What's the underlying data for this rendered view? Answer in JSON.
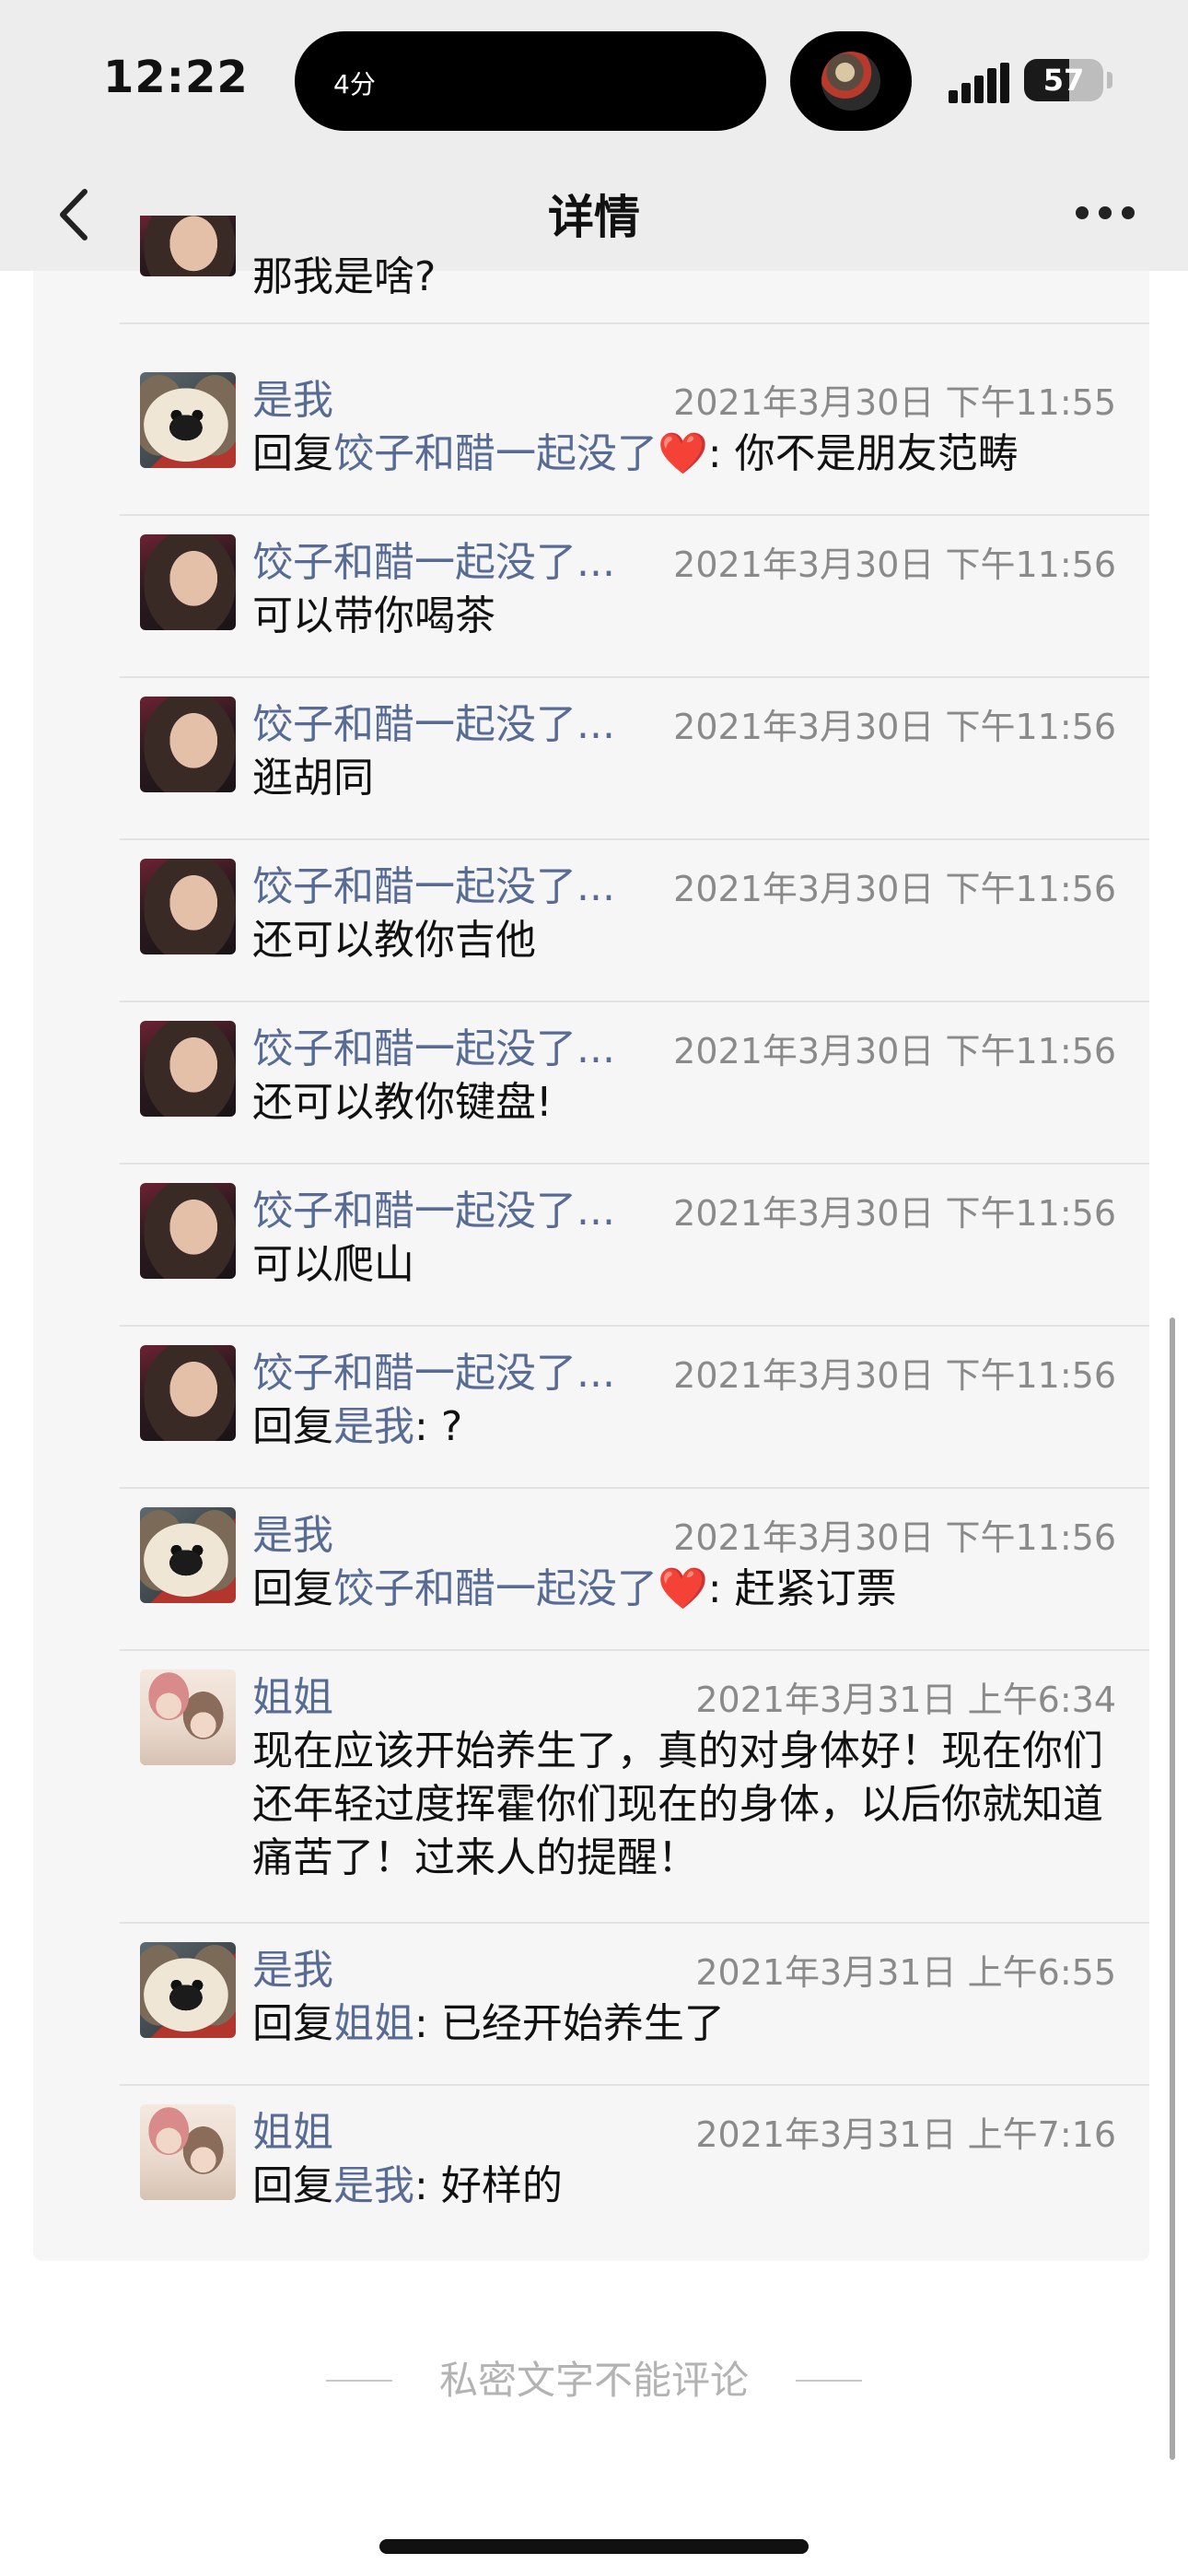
{
  "status_bar": {
    "time": "12:22",
    "island_label": "4分",
    "battery_level": "57",
    "battery_fraction": 0.57
  },
  "nav": {
    "title": "详情",
    "back_icon": "chevron-left-icon",
    "more_icon": "more-dots-icon"
  },
  "comments": [
    {
      "avatar": "girl",
      "name": "",
      "timestamp": "",
      "reply_prefix": "",
      "reply_to": "",
      "reply_sep": "",
      "text": "那我是啥?"
    },
    {
      "avatar": "dog",
      "name": "是我",
      "timestamp": "2021年3月30日 下午11:55",
      "reply_prefix": "回复",
      "reply_to": "饺子和醋一起没了",
      "reply_heart": "❤️",
      "reply_sep": ":",
      "text": " 你不是朋友范畴"
    },
    {
      "avatar": "girl",
      "name": "饺子和醋一起没了...",
      "timestamp": "2021年3月30日 下午11:56",
      "reply_prefix": "",
      "reply_to": "",
      "reply_sep": "",
      "text": "可以带你喝茶"
    },
    {
      "avatar": "girl",
      "name": "饺子和醋一起没了...",
      "timestamp": "2021年3月30日 下午11:56",
      "reply_prefix": "",
      "reply_to": "",
      "reply_sep": "",
      "text": "逛胡同"
    },
    {
      "avatar": "girl",
      "name": "饺子和醋一起没了...",
      "timestamp": "2021年3月30日 下午11:56",
      "reply_prefix": "",
      "reply_to": "",
      "reply_sep": "",
      "text": "还可以教你吉他"
    },
    {
      "avatar": "girl",
      "name": "饺子和醋一起没了...",
      "timestamp": "2021年3月30日 下午11:56",
      "reply_prefix": "",
      "reply_to": "",
      "reply_sep": "",
      "text": "还可以教你键盘!"
    },
    {
      "avatar": "girl",
      "name": "饺子和醋一起没了...",
      "timestamp": "2021年3月30日 下午11:56",
      "reply_prefix": "",
      "reply_to": "",
      "reply_sep": "",
      "text": "可以爬山"
    },
    {
      "avatar": "girl",
      "name": "饺子和醋一起没了...",
      "timestamp": "2021年3月30日 下午11:56",
      "reply_prefix": "回复",
      "reply_to": "是我",
      "reply_heart": "",
      "reply_sep": ":",
      "text": " ?"
    },
    {
      "avatar": "dog",
      "name": "是我",
      "timestamp": "2021年3月30日 下午11:56",
      "reply_prefix": "回复",
      "reply_to": "饺子和醋一起没了",
      "reply_heart": "❤️",
      "reply_sep": ":",
      "text": " 赶紧订票"
    },
    {
      "avatar": "sister",
      "name": "姐姐",
      "timestamp": "2021年3月31日 上午6:34",
      "reply_prefix": "",
      "reply_to": "",
      "reply_sep": "",
      "text": "现在应该开始养生了，真的对身体好！现在你们还年轻过度挥霍你们现在的身体，以后你就知道痛苦了！过来人的提醒！"
    },
    {
      "avatar": "dog",
      "name": "是我",
      "timestamp": "2021年3月31日 上午6:55",
      "reply_prefix": "回复",
      "reply_to": "姐姐",
      "reply_heart": "",
      "reply_sep": ":",
      "text": " 已经开始养生了"
    },
    {
      "avatar": "sister",
      "name": "姐姐",
      "timestamp": "2021年3月31日 上午7:16",
      "reply_prefix": "回复",
      "reply_to": "是我",
      "reply_heart": "",
      "reply_sep": ":",
      "text": " 好样的"
    }
  ],
  "footer": {
    "text": "私密文字不能评论"
  }
}
